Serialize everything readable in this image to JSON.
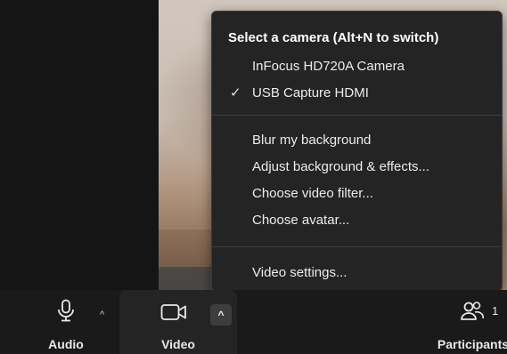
{
  "camera_menu": {
    "title": "Select a camera (Alt+N to switch)",
    "cameras": [
      {
        "label": "InFocus HD720A Camera",
        "selected": false
      },
      {
        "label": "USB Capture HDMI",
        "selected": true
      }
    ],
    "background_items": [
      "Blur my background",
      "Adjust background & effects...",
      "Choose video filter...",
      "Choose avatar..."
    ],
    "settings_item": "Video settings...",
    "check_glyph": "✓"
  },
  "toolbar": {
    "audio_label": "Audio",
    "video_label": "Video",
    "participants_label": "Participants",
    "participants_count": "1",
    "chevron_glyph": "^"
  },
  "icons": {
    "audio": "microphone-icon",
    "video": "video-camera-icon",
    "participants": "participants-icon"
  },
  "colors": {
    "menu_bg": "#242424",
    "toolbar_bg": "#1a1a1a",
    "text": "#ececec"
  }
}
